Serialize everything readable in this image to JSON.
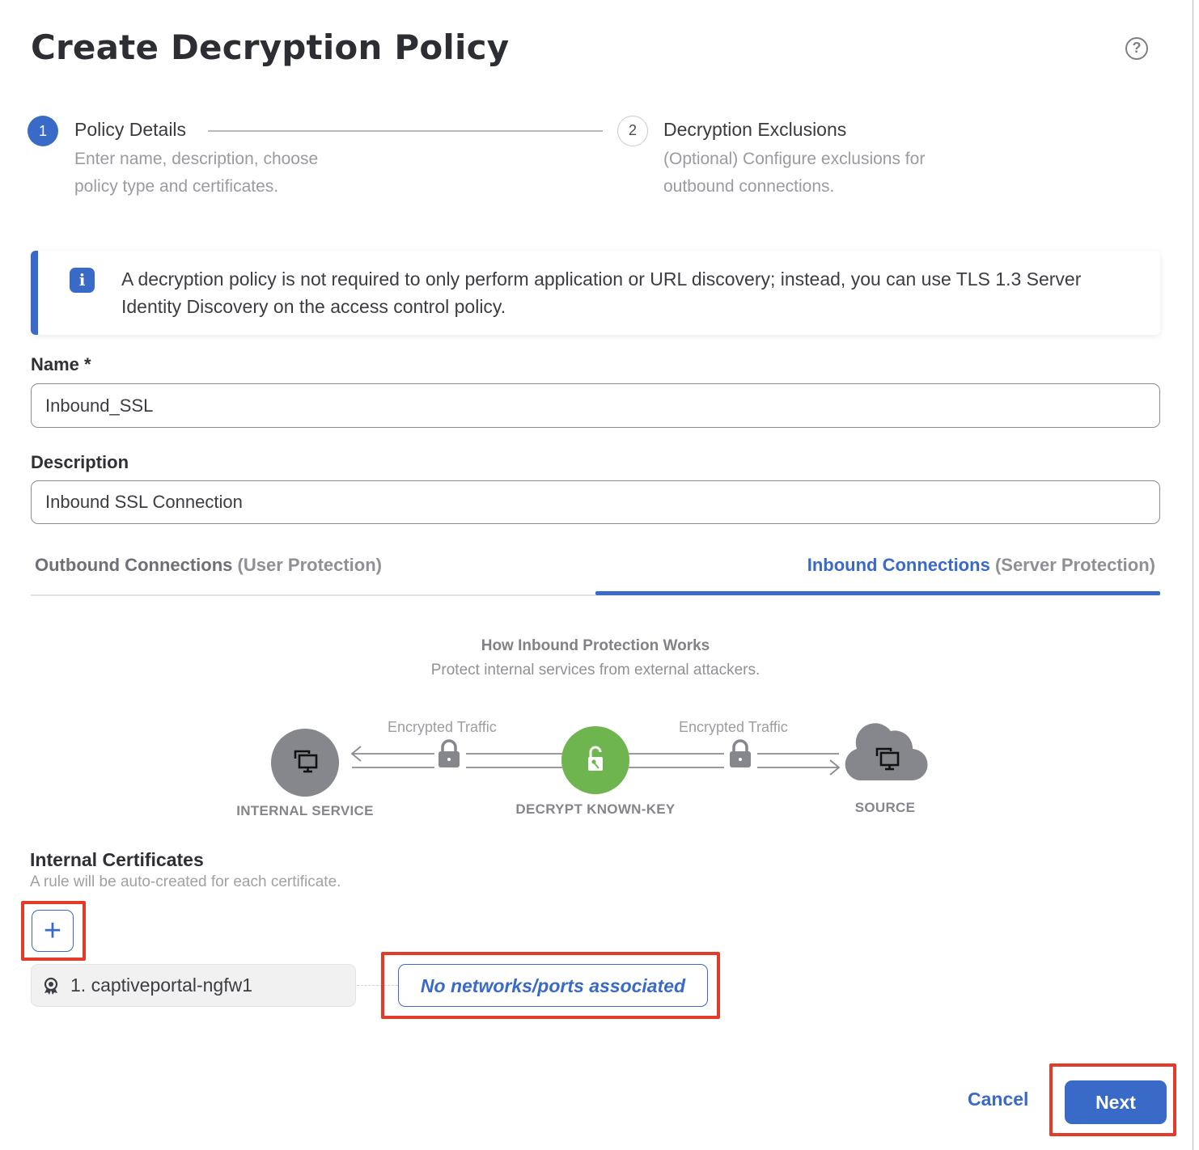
{
  "header": {
    "title": "Create Decryption Policy",
    "help_icon": "help-circle-icon"
  },
  "stepper": {
    "steps": [
      {
        "number": "1",
        "title": "Policy Details",
        "description": "Enter name, description, choose policy type and certificates.",
        "state": "active"
      },
      {
        "number": "2",
        "title": "Decryption Exclusions",
        "description": "(Optional) Configure exclusions for outbound connections.",
        "state": "pending"
      }
    ]
  },
  "alert": {
    "icon": "info-icon",
    "text": "A decryption policy is not required to only perform application or URL discovery; instead, you can use TLS 1.3 Server Identity Discovery on the access control policy."
  },
  "form": {
    "name_label": "Name *",
    "name_value": "Inbound_SSL",
    "description_label": "Description",
    "description_value": "Inbound SSL Connection"
  },
  "tabs": [
    {
      "label": "Outbound Connections",
      "sublabel": "(User Protection)",
      "selected": false
    },
    {
      "label": "Inbound Connections",
      "sublabel": "(Server Protection)",
      "selected": true
    }
  ],
  "diagram": {
    "title": "How Inbound Protection Works",
    "subtitle": "Protect internal services from external attackers.",
    "traffic_left": "Encrypted Traffic",
    "traffic_right": "Encrypted Traffic",
    "nodes": [
      {
        "label": "INTERNAL SERVICE",
        "icon": "monitor-icon"
      },
      {
        "label": "DECRYPT KNOWN-KEY",
        "icon": "unlock-key-icon"
      },
      {
        "label": "SOURCE",
        "icon": "cloud-monitor-icon"
      }
    ]
  },
  "certificates": {
    "title": "Internal Certificates",
    "subtitle": "A rule will be auto-created for each certificate.",
    "add_icon": "plus-icon",
    "items": [
      {
        "name": "1. captiveportal-ngfw1",
        "icon": "certificate-icon",
        "association": "No networks/ports associated"
      }
    ]
  },
  "footer": {
    "cancel_label": "Cancel",
    "next_label": "Next"
  },
  "colors": {
    "accent": "#3a6ac8",
    "decrypt_node": "#6eb550",
    "node_gray": "#85878c",
    "highlight": "#e23b2a"
  }
}
